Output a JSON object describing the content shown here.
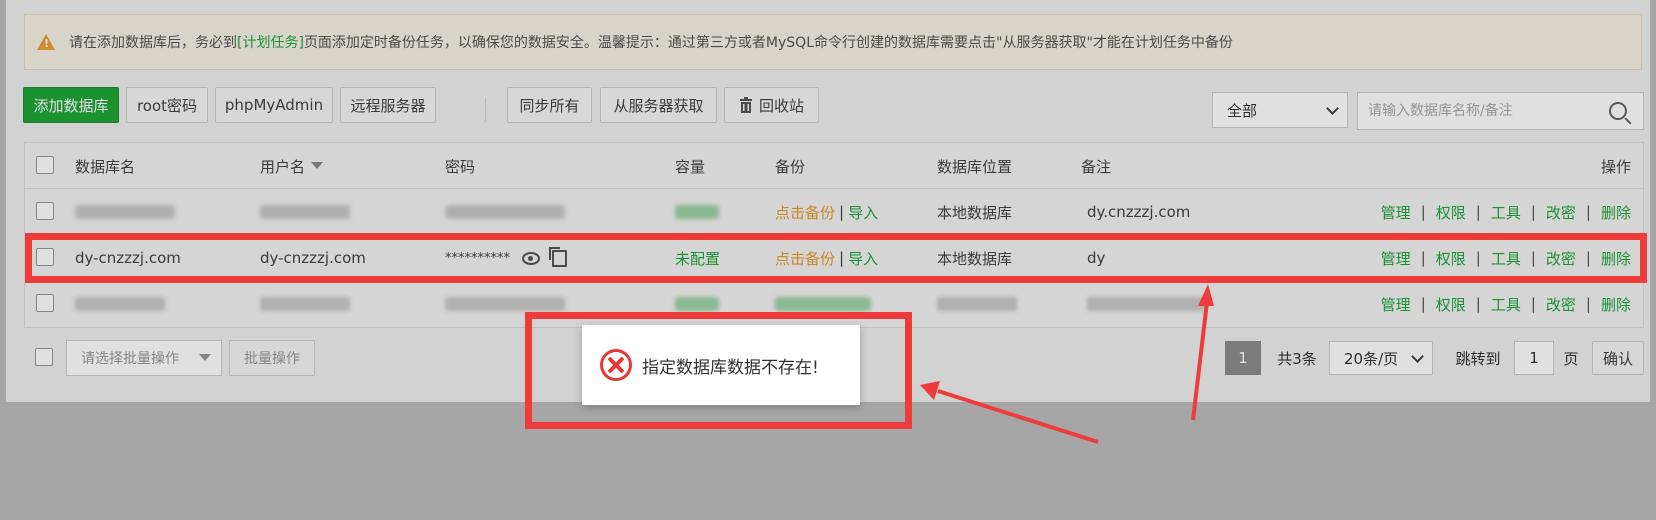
{
  "notice": {
    "text_before": "请在添加数据库后，务必到",
    "link": "[计划任务]",
    "text_after": "页面添加定时备份任务，以确保您的数据安全。温馨提示：通过第三方或者MySQL命令行创建的数据库需要点击\"从服务器获取\"才能在计划任务中备份"
  },
  "toolbar": {
    "add_db": "添加数据库",
    "root_pwd": "root密码",
    "phpmyadmin": "phpMyAdmin",
    "remote": "远程服务器",
    "sync_all": "同步所有",
    "fetch_server": "从服务器获取",
    "recycle": "回收站",
    "filter_value": "全部",
    "search_placeholder": "请输入数据库名称/备注"
  },
  "table": {
    "headers": {
      "name": "数据库名",
      "user": "用户名",
      "password": "密码",
      "capacity": "容量",
      "backup": "备份",
      "location": "数据库位置",
      "remark": "备注",
      "ops": "操作"
    },
    "rows": [
      {
        "name": "",
        "user": "",
        "password": "",
        "capacity": "",
        "backup": "点击备份",
        "import": "导入",
        "location": "本地数据库",
        "remark": "dy.cnzzzj.com"
      },
      {
        "name": "dy-cnzzzj.com",
        "user": "dy-cnzzzj.com",
        "password": "**********",
        "capacity": "未配置",
        "backup": "点击备份",
        "import": "导入",
        "location": "本地数据库",
        "remark": "dy"
      },
      {
        "name": "",
        "user": "",
        "password": "",
        "capacity": "",
        "backup": "",
        "import": "",
        "location": "",
        "remark": ""
      }
    ],
    "ops": [
      "管理",
      "权限",
      "工具",
      "改密",
      "删除"
    ],
    "separator": "|"
  },
  "footer": {
    "batch_placeholder": "请选择批量操作",
    "batch_btn": "批量操作",
    "current_page": "1",
    "total": "共3条",
    "per_page": "20条/页",
    "jump_label": "跳转到",
    "jump_value": "1",
    "page_unit": "页",
    "confirm": "确认"
  },
  "toast": {
    "message": "指定数据库数据不存在!"
  },
  "colors": {
    "accent": "#20a53a",
    "warning": "#e69a2c",
    "highlight": "#ef3b3b",
    "error": "#e53935"
  },
  "icons": [
    "warning-icon",
    "trash-icon",
    "search-icon",
    "chevron-down-icon",
    "sort-down-icon",
    "eye-icon",
    "copy-icon",
    "error-icon"
  ]
}
